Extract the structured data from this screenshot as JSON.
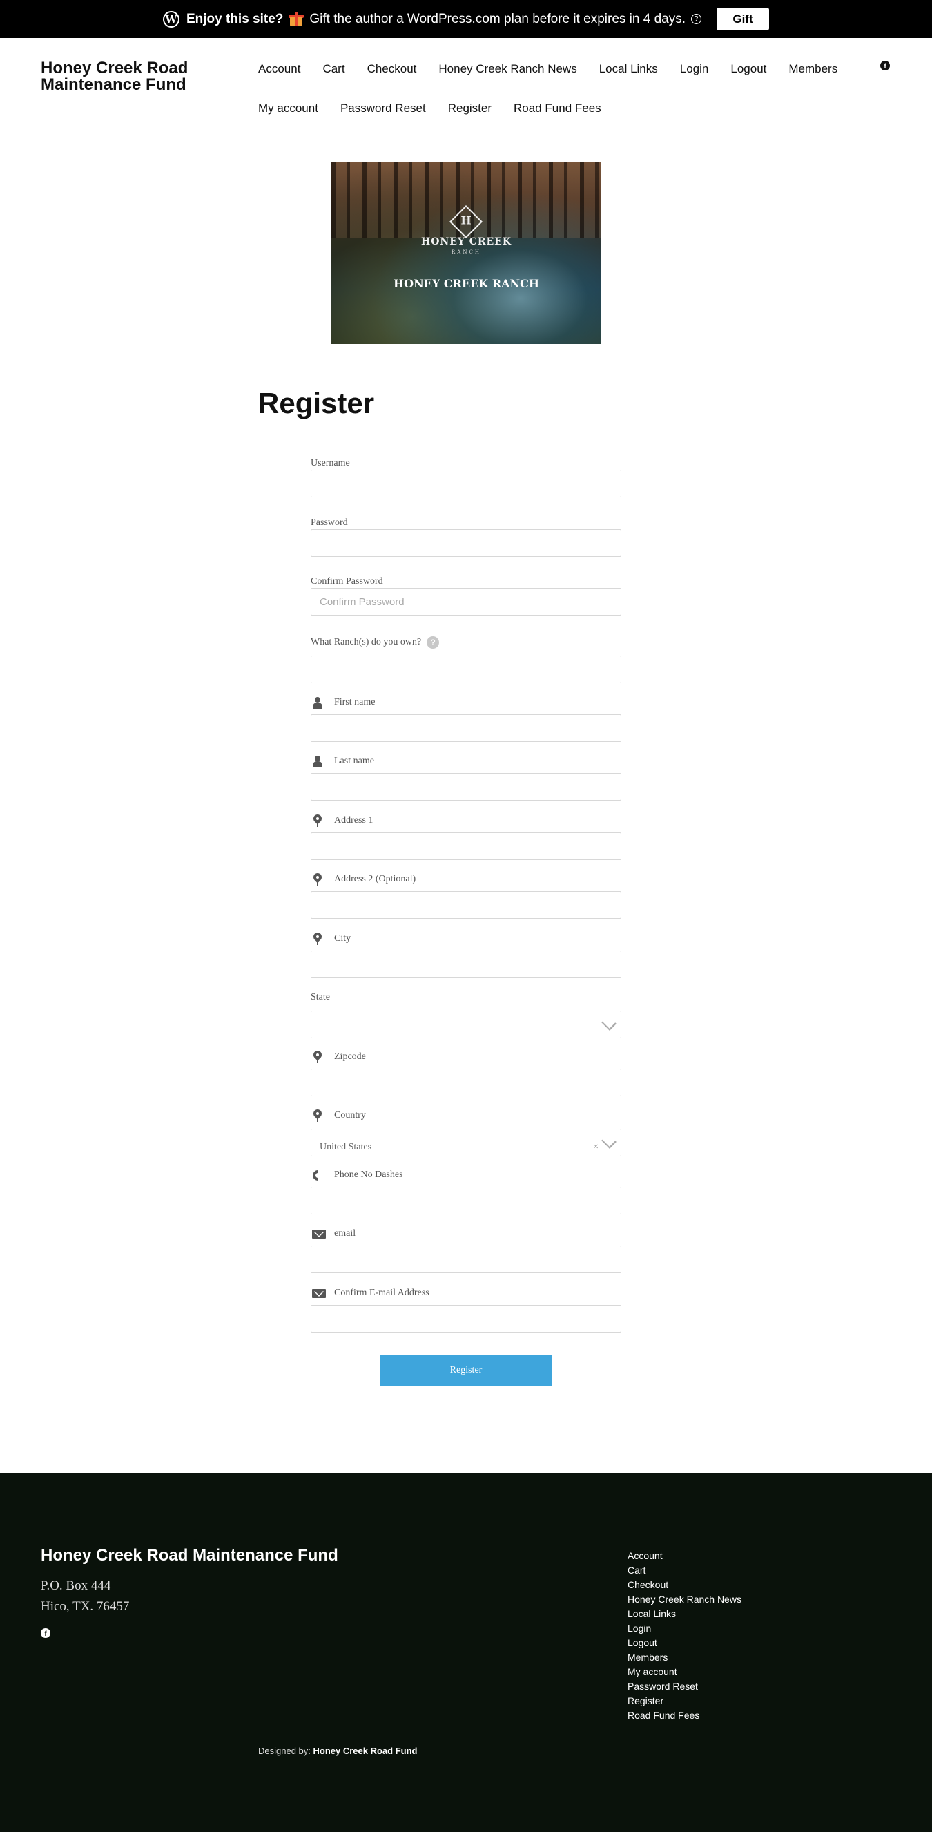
{
  "banner": {
    "bold_text": "Enjoy this site?",
    "message": "Gift the author a WordPress.com plan before it expires in 4 days.",
    "gift_label": "Gift"
  },
  "header": {
    "site_title": "Honey Creek Road Maintenance Fund",
    "nav_row1": [
      "Account",
      "Cart",
      "Checkout",
      "Honey Creek Ranch News",
      "Local Links",
      "Login",
      "Logout",
      "Members"
    ],
    "nav_row2": [
      "My account",
      "Password Reset",
      "Register",
      "Road Fund Fees"
    ]
  },
  "hero": {
    "logo_letter": "H",
    "logo_name": "HONEY CREEK",
    "logo_sub": "RANCH",
    "caption": "HONEY CREEK RANCH"
  },
  "form": {
    "title": "Register",
    "fields": {
      "username": {
        "label": "Username",
        "value": ""
      },
      "password": {
        "label": "Password",
        "value": ""
      },
      "confirm_password": {
        "label": "Confirm Password",
        "placeholder": "Confirm Password"
      },
      "ranch": {
        "label": "What Ranch(s) do you own?",
        "help": "?",
        "value": ""
      },
      "first_name": {
        "label": "First name",
        "icon": "user-icon"
      },
      "last_name": {
        "label": "Last name",
        "icon": "user-icon"
      },
      "address1": {
        "label": "Address 1",
        "icon": "map-pin-icon"
      },
      "address2": {
        "label": "Address 2 (Optional)",
        "icon": "map-pin-icon"
      },
      "city": {
        "label": "City",
        "icon": "map-pin-icon"
      },
      "state": {
        "label": "State",
        "value": ""
      },
      "zipcode": {
        "label": "Zipcode",
        "icon": "map-pin-icon"
      },
      "country": {
        "label": "Country",
        "icon": "map-pin-icon",
        "value": "United States",
        "clear": "×"
      },
      "phone": {
        "label": "Phone No Dashes",
        "icon": "phone-icon"
      },
      "email": {
        "label": "email",
        "icon": "envelope-icon"
      },
      "confirm_email": {
        "label": "Confirm E-mail Address",
        "icon": "envelope-icon"
      }
    },
    "submit_label": "Register",
    "submit_color": "#3ea5dc"
  },
  "footer": {
    "title": "Honey Creek Road Maintenance Fund",
    "address_line1": "P.O. Box 444",
    "address_line2": "Hico, TX. 76457",
    "nav": [
      "Account",
      "Cart",
      "Checkout",
      "Honey Creek Ranch News",
      "Local Links",
      "Login",
      "Logout",
      "Members",
      "My account",
      "Password Reset",
      "Register",
      "Road Fund Fees"
    ],
    "credit_prefix": "Designed by:",
    "credit_name": "Honey Creek Road Fund",
    "background": "#0a120b"
  }
}
